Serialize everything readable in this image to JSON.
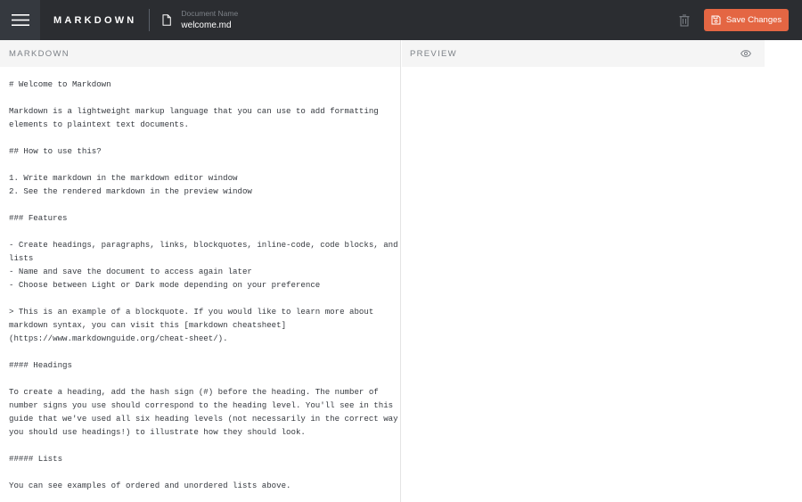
{
  "header": {
    "brand": "MARKDOWN",
    "document_label": "Document Name",
    "document_name": "welcome.md",
    "save_label": "Save Changes"
  },
  "editor": {
    "title": "MARKDOWN",
    "lines": [
      "# Welcome to Markdown",
      "",
      "Markdown is a lightweight markup language that you can use to add formatting",
      "elements to plaintext text documents.",
      "",
      "## How to use this?",
      "",
      "1. Write markdown in the markdown editor window",
      "2. See the rendered markdown in the preview window",
      "",
      "### Features",
      "",
      "- Create headings, paragraphs, links, blockquotes, inline-code, code blocks, and",
      "lists",
      "- Name and save the document to access again later",
      "- Choose between Light or Dark mode depending on your preference",
      "",
      "> This is an example of a blockquote. If you would like to learn more about",
      "markdown syntax, you can visit this [markdown cheatsheet]",
      "(https://www.markdownguide.org/cheat-sheet/).",
      "",
      "#### Headings",
      "",
      "To create a heading, add the hash sign (#) before the heading. The number of",
      "number signs you use should correspond to the heading level. You'll see in this",
      "guide that we've used all six heading levels (not necessarily in the correct way",
      "you should use headings!) to illustrate how they should look.",
      "",
      "##### Lists",
      "",
      "You can see examples of ordered and unordered lists above."
    ]
  },
  "preview": {
    "title": "PREVIEW"
  },
  "icons": {
    "menu": "hamburger-icon",
    "document": "document-icon",
    "delete": "trash-icon",
    "save": "save-icon",
    "preview_toggle": "eye-icon"
  },
  "colors": {
    "topbar": "#2b2d31",
    "menu_bg": "#35393f",
    "accent": "#e46643",
    "pane_header": "#f5f5f5",
    "muted_text": "#7c8187",
    "editor_text": "#35393f"
  }
}
